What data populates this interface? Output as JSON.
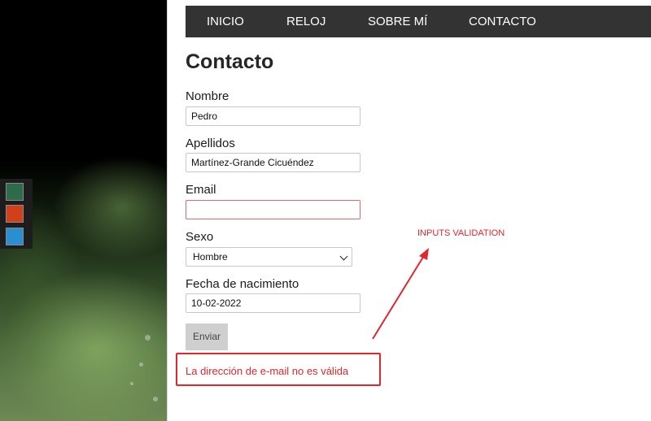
{
  "nav": {
    "items": [
      "INICIO",
      "RELOJ",
      "SOBRE MÍ",
      "CONTACTO"
    ]
  },
  "page": {
    "title": "Contacto"
  },
  "form": {
    "nombre_label": "Nombre",
    "nombre_value": "Pedro",
    "apellidos_label": "Apellidos",
    "apellidos_value": "Martínez-Grande Cicuéndez",
    "email_label": "Email",
    "email_value": "",
    "sexo_label": "Sexo",
    "sexo_value": "Hombre",
    "fecha_label": "Fecha de nacimiento",
    "fecha_value": "10-02-2022",
    "submit_label": "Enviar",
    "error_message": "La dirección de e-mail no es válida"
  },
  "annotation": {
    "text": "INPUTS VALIDATION"
  },
  "theme_swatches": [
    {
      "name": "green",
      "color": "#2e6b4a"
    },
    {
      "name": "orange",
      "color": "#d2401b"
    },
    {
      "name": "blue",
      "color": "#2a8fd0"
    }
  ],
  "colors": {
    "nav_bg": "#333333",
    "error": "#e3262c"
  }
}
